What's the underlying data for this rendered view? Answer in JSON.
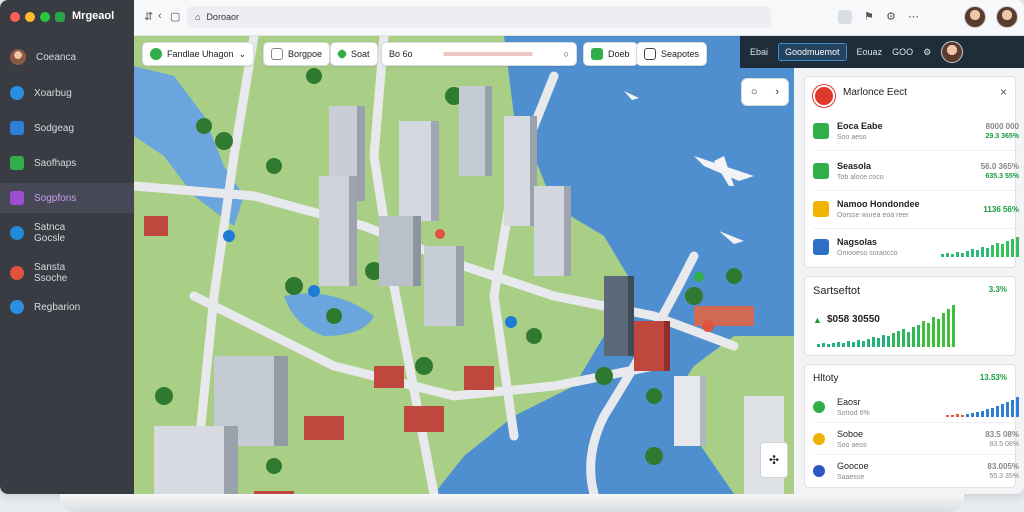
{
  "app": {
    "title": "Mrgeaol"
  },
  "sidebar": {
    "items": [
      {
        "label": "Coeanca",
        "icon": "user-avatar-icon"
      },
      {
        "label": "Xoarbug",
        "icon": "globe-icon"
      },
      {
        "label": "Sodgeag",
        "icon": "layers-icon"
      },
      {
        "label": "Saofhaps",
        "icon": "map-icon"
      },
      {
        "label": "Sogpfons",
        "icon": "grid-icon"
      },
      {
        "label": "Satnca\nGocsle",
        "icon": "compass-icon"
      },
      {
        "label": "Sansta\nSsoche",
        "icon": "target-icon"
      },
      {
        "label": "Regbarion",
        "icon": "bookmark-icon"
      }
    ]
  },
  "topbar": {
    "url": "Doroaor"
  },
  "map_toolbar": {
    "region": "Fandlae Uhagon",
    "filter": "Borgpoe",
    "layer": "Soat",
    "search_label": "Bo 6o",
    "action1": "Doeb",
    "action2": "Seapotes"
  },
  "right_header": {
    "tab1": "Ebai",
    "tab2": "Goodmuemot",
    "tab3": "Eouaz",
    "tab4": "GOO"
  },
  "summary_card": {
    "title": "Marlonce Eect",
    "rows": [
      {
        "name": "Eoca Eabe",
        "sub": "Soo aeso",
        "value": "8000 000",
        "value2": "29.3 365%"
      },
      {
        "name": "Seasola",
        "sub": "Tob aloce coco",
        "value": "56.0 365%",
        "value2": "635.3 55%"
      },
      {
        "name": "Namoo Hondondee",
        "sub": "Oorsse wurea eoa reer",
        "value": "1136 56%",
        "value2": ""
      },
      {
        "name": "Nagsolas",
        "sub": "Omooeso soraocco",
        "value": "",
        "value2": ""
      }
    ]
  },
  "stat_card": {
    "title": "Sartseftot",
    "percent": "3.3%",
    "value": "$058 30550"
  },
  "history_card": {
    "title": "Hltoty",
    "percent": "13.53%",
    "rows": [
      {
        "name": "Eaosr",
        "sub": "Sotrod 6%"
      },
      {
        "name": "Soboe",
        "sub": "Soo aeos",
        "value": "83.5 08%",
        "value2": "83.5 08%"
      },
      {
        "name": "Goocoe",
        "sub": "Saaesse",
        "value": "83.005%",
        "value2": "55.3 35%"
      }
    ]
  },
  "colors": {
    "accent": "#1f2c3a",
    "positive": "#1a9b3f",
    "sidebar": "#3a3c44"
  }
}
